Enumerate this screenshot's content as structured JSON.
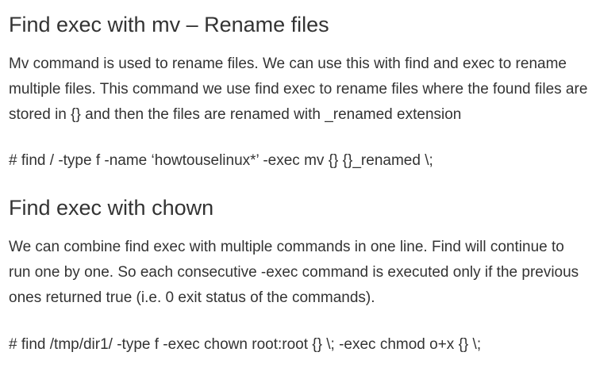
{
  "sections": [
    {
      "title": "Find exec with mv – Rename files",
      "body": "Mv command is used to rename files. We can use this with find and exec to rename multiple files. This command we use find exec to rename files where the found files are stored in {} and then the files are renamed with _renamed extension",
      "command": "# find / -type f -name ‘howtouselinux*’ -exec mv {} {}_renamed \\;"
    },
    {
      "title": "Find exec with chown",
      "body": "We can combine find exec with multiple commands in one line. Find will continue to run one by one. So each consecutive -exec command is executed only if the previous ones returned true (i.e. 0 exit status of the commands).",
      "command": "# find /tmp/dir1/ -type f -exec chown root:root {} \\; -exec chmod o+x {} \\;"
    }
  ]
}
